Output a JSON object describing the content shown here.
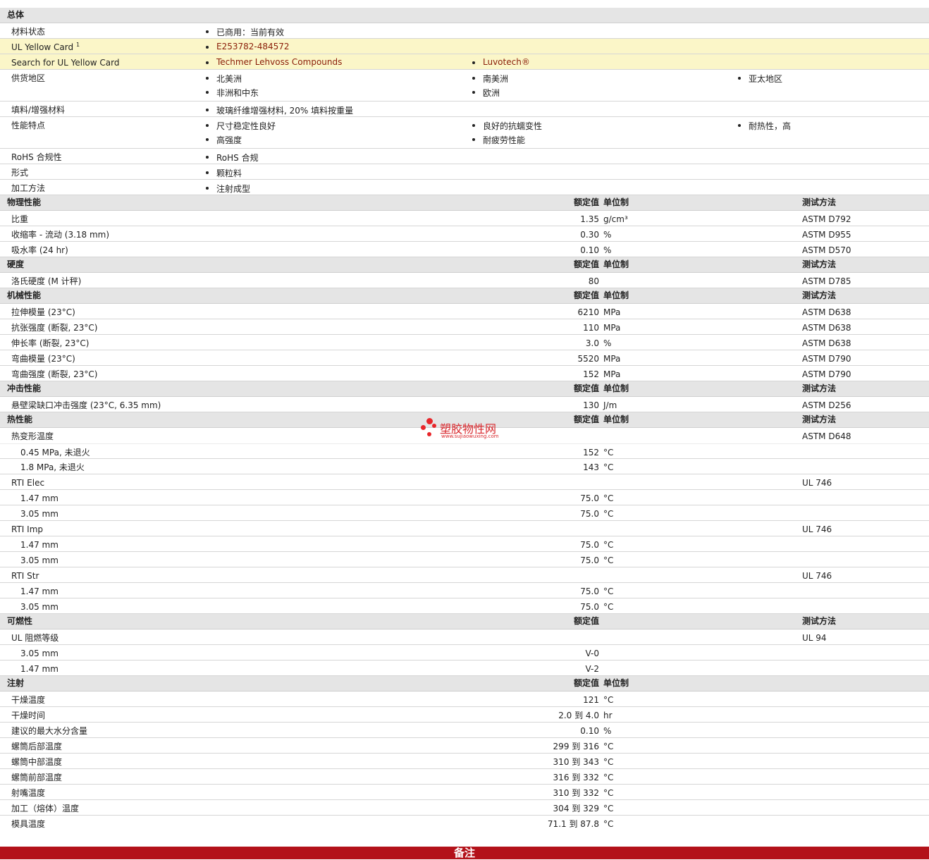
{
  "general": {
    "title": "总体",
    "material_status": {
      "label": "材料状态",
      "value": "已商用：当前有效"
    },
    "ul_card": {
      "label": "UL Yellow Card",
      "sup": "1",
      "value": "E253782-484572"
    },
    "ul_search": {
      "label": "Search for UL Yellow Card",
      "v1": "Techmer Lehvoss Compounds",
      "v2": "Luvotech®"
    },
    "supply": {
      "label": "供货地区",
      "a": "北美洲",
      "b": "南美洲",
      "c": "亚太地区",
      "d": "非洲和中东",
      "e": "欧洲"
    },
    "filler": {
      "label": "填料/增强材料",
      "value": "玻璃纤维增强材料, 20% 填料按重量"
    },
    "features": {
      "label": "性能特点",
      "a": "尺寸稳定性良好",
      "b": "良好的抗蠕变性",
      "c": "耐热性，高",
      "d": "高强度",
      "e": "耐疲劳性能"
    },
    "rohs": {
      "label": "RoHS 合规性",
      "value": "RoHS 合规"
    },
    "form": {
      "label": "形式",
      "value": "颗粒料"
    },
    "process": {
      "label": "加工方法",
      "value": "注射成型"
    }
  },
  "headers": {
    "rated": "额定值",
    "unit": "单位制",
    "test": "测试方法"
  },
  "physical": {
    "title": "物理性能",
    "rows": [
      {
        "label": "比重",
        "value": "1.35",
        "unit": "g/cm³",
        "test": "ASTM D792"
      },
      {
        "label": "收缩率  - 流动  (3.18 mm)",
        "value": "0.30",
        "unit": "%",
        "test": "ASTM D955"
      },
      {
        "label": "吸水率  (24 hr)",
        "value": "0.10",
        "unit": "%",
        "test": "ASTM D570"
      }
    ]
  },
  "hardness": {
    "title": "硬度",
    "rows": [
      {
        "label": "洛氏硬度  (M 计秤)",
        "value": "80",
        "unit": "",
        "test": "ASTM D785"
      }
    ]
  },
  "mechanical": {
    "title": "机械性能",
    "rows": [
      {
        "label": "拉伸模量  (23°C)",
        "value": "6210",
        "unit": "MPa",
        "test": "ASTM D638"
      },
      {
        "label": "抗张强度  (断裂, 23°C)",
        "value": "110",
        "unit": "MPa",
        "test": "ASTM D638"
      },
      {
        "label": "伸长率  (断裂, 23°C)",
        "value": "3.0",
        "unit": "%",
        "test": "ASTM D638"
      },
      {
        "label": "弯曲模量  (23°C)",
        "value": "5520",
        "unit": "MPa",
        "test": "ASTM D790"
      },
      {
        "label": "弯曲强度  (断裂, 23°C)",
        "value": "152",
        "unit": "MPa",
        "test": "ASTM D790"
      }
    ]
  },
  "impact": {
    "title": "冲击性能",
    "rows": [
      {
        "label": "悬壁梁缺口冲击强度  (23°C, 6.35 mm)",
        "value": "130",
        "unit": "J/m",
        "test": "ASTM D256"
      }
    ]
  },
  "thermal": {
    "title": "热性能",
    "hdt": {
      "label": "热变形温度",
      "test": "ASTM D648",
      "rows": [
        {
          "label": "0.45 MPa, 未退火",
          "value": "152",
          "unit": "°C"
        },
        {
          "label": "1.8 MPa, 未退火",
          "value": "143",
          "unit": "°C"
        }
      ]
    },
    "rti_elec": {
      "label": "RTI Elec",
      "test": "UL 746",
      "rows": [
        {
          "label": "1.47 mm",
          "value": "75.0",
          "unit": "°C"
        },
        {
          "label": "3.05 mm",
          "value": "75.0",
          "unit": "°C"
        }
      ]
    },
    "rti_imp": {
      "label": "RTI Imp",
      "test": "UL 746",
      "rows": [
        {
          "label": "1.47 mm",
          "value": "75.0",
          "unit": "°C"
        },
        {
          "label": "3.05 mm",
          "value": "75.0",
          "unit": "°C"
        }
      ]
    },
    "rti_str": {
      "label": "RTI Str",
      "test": "UL 746",
      "rows": [
        {
          "label": "1.47 mm",
          "value": "75.0",
          "unit": "°C"
        },
        {
          "label": "3.05 mm",
          "value": "75.0",
          "unit": "°C"
        }
      ]
    }
  },
  "flammability": {
    "title": "可燃性",
    "ul": {
      "label": "UL 阻燃等级",
      "test": "UL 94",
      "rows": [
        {
          "label": "3.05 mm",
          "value": "V-0"
        },
        {
          "label": "1.47 mm",
          "value": "V-2"
        }
      ]
    }
  },
  "injection": {
    "title": "注射",
    "rows": [
      {
        "label": "干燥温度",
        "value": "121",
        "unit": "°C"
      },
      {
        "label": "干燥时间",
        "value": "2.0  到   4.0",
        "unit": "hr"
      },
      {
        "label": "建议的最大水分含量",
        "value": "0.10",
        "unit": "%"
      },
      {
        "label": "螺筒后部温度",
        "value": "299  到   316",
        "unit": "°C"
      },
      {
        "label": "螺筒中部温度",
        "value": "310  到   343",
        "unit": "°C"
      },
      {
        "label": "螺筒前部温度",
        "value": "316  到   332",
        "unit": "°C"
      },
      {
        "label": "射嘴温度",
        "value": "310  到   332",
        "unit": "°C"
      },
      {
        "label": "加工（熔体）温度",
        "value": "304  到   329",
        "unit": "°C"
      },
      {
        "label": "模具温度",
        "value": "71.1  到   87.8",
        "unit": "°C"
      }
    ]
  },
  "footer": {
    "label": "备注"
  },
  "watermark": {
    "title": "塑胶物性网",
    "url": "www.sujiaowuxing.com"
  }
}
